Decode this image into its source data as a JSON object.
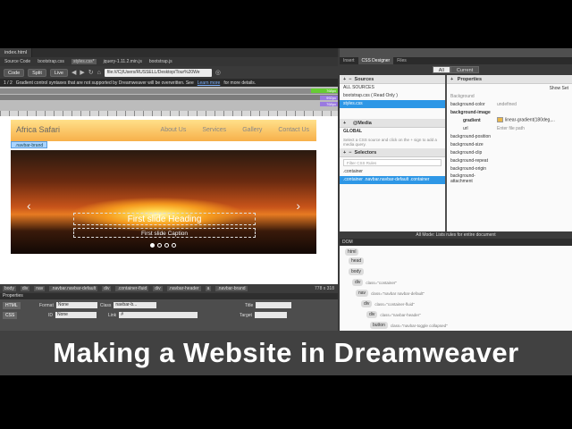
{
  "window": {
    "doc_tab": "index.html",
    "related_files": [
      "Source Code",
      "bootstrap.css",
      "styles.css*",
      "jquery-1.11.2.min.js",
      "bootstrap.js"
    ],
    "active_related": "styles.css*"
  },
  "toolbar": {
    "code": "Code",
    "split": "Split",
    "live": "Live",
    "url": "file:///C|/Users/RUSSELL/Desktop/Tour%20We"
  },
  "warning": {
    "counter": "1 / 2",
    "message": "Gradient control syntaxes that are not supported by Dreamweaver will be overwritten. See",
    "link": "Learn more",
    "tail": "for more details."
  },
  "media_queries": {
    "mq1": "768px",
    "mq2": "992px",
    "mq3": "768px"
  },
  "page": {
    "brand": "Africa Safari",
    "nav": [
      "About Us",
      "Services",
      "Gallery",
      "Contact Us"
    ],
    "brand_tag": ".navbar-brand",
    "caption_heading": "First slide Heading",
    "caption_text": "First slide Caption",
    "prev_arrow": "‹",
    "next_arrow": "›"
  },
  "tag_selector": {
    "tags": [
      "body",
      "div",
      "nav",
      ".navbar.navbar-default",
      "div",
      ".container-fluid",
      "div",
      ".navbar-header",
      "a",
      ".navbar-brand"
    ],
    "dims": "778 x 318"
  },
  "properties": {
    "title": "Properties",
    "html_btn": "HTML",
    "css_btn": "CSS",
    "format_label": "Format",
    "format_value": "None",
    "id_label": "ID",
    "id_value": "None",
    "class_label": "Class",
    "class_value": "navbar-b...",
    "link_label": "Link",
    "link_value": "#",
    "title_label": "Title",
    "target_label": "Target"
  },
  "right": {
    "tabs": [
      "Insert",
      "CSS Designer",
      "Files"
    ],
    "active_tab": "CSS Designer",
    "all": "All",
    "current": "Current",
    "sources_h": "Sources",
    "sources": [
      "ALL SOURCES",
      "bootstrap.css  ( Read Only )",
      "styles.css"
    ],
    "media_h": "@Media",
    "global": "GLOBAL",
    "media_hint": "Select a CSS source and click on the + sign to add a media query.",
    "selectors_h": "Selectors",
    "filter": "Filter CSS Rules",
    "selectors": [
      ".container",
      ".container .navbar.navbar-default .container"
    ],
    "properties_h": "Properties",
    "show_set": "Show Set",
    "background_h": "Background",
    "bg_color_k": "background-color",
    "bg_color_v": "undefined",
    "bg_image_h": "background-image",
    "gradient_k": "gradient",
    "gradient_v": "linear-gradient(180deg,...",
    "url_k": "url",
    "url_v": "Enter file path",
    "props": [
      "background-position",
      "background-size",
      "background-clip",
      "background-repeat",
      "background-origin",
      "background-attachment"
    ],
    "status": "All Mode: Lists rules for entire document",
    "dom_h": "DOM"
  },
  "dom": {
    "nodes": [
      {
        "tag": "html"
      },
      {
        "tag": "head"
      },
      {
        "tag": "body"
      },
      {
        "tag": "div",
        "attr": "class=\"container\""
      },
      {
        "tag": "nav",
        "attr": "class=\"navbar navbar-default\""
      },
      {
        "tag": "div",
        "attr": "class=\"container-fluid\""
      },
      {
        "tag": "div",
        "attr": "class=\"navbar-header\""
      },
      {
        "tag": "button",
        "attr": "class=\"navbar-toggle collapsed\""
      }
    ]
  },
  "banner": {
    "title": "Making a Website in Dreamweaver"
  }
}
